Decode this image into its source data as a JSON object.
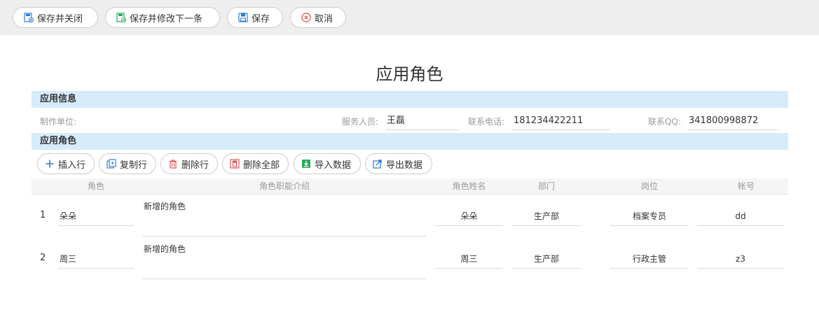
{
  "toolbar": {
    "save_close": "保存并关闭",
    "save_next": "保存并修改下一条",
    "save": "保存",
    "cancel": "取消"
  },
  "page_title": "应用角色",
  "info_section": {
    "title": "应用信息",
    "unit_label": "制作单位:",
    "unit_value": "",
    "staff_label": "服务人员:",
    "staff_value": "王磊",
    "phone_label": "联系电话:",
    "phone_value": "181234422211",
    "qq_label": "联系QQ:",
    "qq_value": "341800998872"
  },
  "roles_section": {
    "title": "应用角色",
    "buttons": {
      "insert": "插入行",
      "copy": "复制行",
      "delete": "删除行",
      "delete_all": "删除全部",
      "import": "导入数据",
      "export": "导出数据"
    },
    "columns": [
      "角色",
      "角色职能介绍",
      "角色姓名",
      "部门",
      "岗位",
      "帐号"
    ],
    "rows": [
      {
        "num": "1",
        "role": "朵朵",
        "desc": "新增的角色",
        "name": "朵朵",
        "dept": "生产部",
        "post": "档案专员",
        "account": "dd"
      },
      {
        "num": "2",
        "role": "周三",
        "desc": "新增的角色",
        "name": "周三",
        "dept": "生产部",
        "post": "行政主管",
        "account": "z3"
      }
    ]
  },
  "colors": {
    "section_bg": "#d6ecfa",
    "toolbar_bg": "#eeeeee",
    "icon_blue": "#2b7bd6",
    "icon_red": "#e04848",
    "icon_green": "#2aa85a"
  }
}
